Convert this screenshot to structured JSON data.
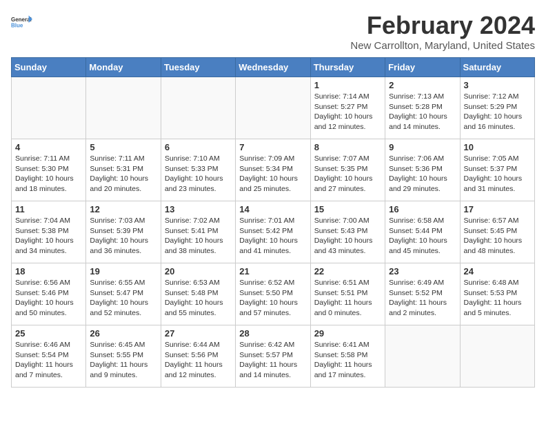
{
  "header": {
    "logo_general": "General",
    "logo_blue": "Blue",
    "month_title": "February 2024",
    "location": "New Carrollton, Maryland, United States"
  },
  "weekdays": [
    "Sunday",
    "Monday",
    "Tuesday",
    "Wednesday",
    "Thursday",
    "Friday",
    "Saturday"
  ],
  "weeks": [
    [
      {
        "day": "",
        "detail": ""
      },
      {
        "day": "",
        "detail": ""
      },
      {
        "day": "",
        "detail": ""
      },
      {
        "day": "",
        "detail": ""
      },
      {
        "day": "1",
        "detail": "Sunrise: 7:14 AM\nSunset: 5:27 PM\nDaylight: 10 hours\nand 12 minutes."
      },
      {
        "day": "2",
        "detail": "Sunrise: 7:13 AM\nSunset: 5:28 PM\nDaylight: 10 hours\nand 14 minutes."
      },
      {
        "day": "3",
        "detail": "Sunrise: 7:12 AM\nSunset: 5:29 PM\nDaylight: 10 hours\nand 16 minutes."
      }
    ],
    [
      {
        "day": "4",
        "detail": "Sunrise: 7:11 AM\nSunset: 5:30 PM\nDaylight: 10 hours\nand 18 minutes."
      },
      {
        "day": "5",
        "detail": "Sunrise: 7:11 AM\nSunset: 5:31 PM\nDaylight: 10 hours\nand 20 minutes."
      },
      {
        "day": "6",
        "detail": "Sunrise: 7:10 AM\nSunset: 5:33 PM\nDaylight: 10 hours\nand 23 minutes."
      },
      {
        "day": "7",
        "detail": "Sunrise: 7:09 AM\nSunset: 5:34 PM\nDaylight: 10 hours\nand 25 minutes."
      },
      {
        "day": "8",
        "detail": "Sunrise: 7:07 AM\nSunset: 5:35 PM\nDaylight: 10 hours\nand 27 minutes."
      },
      {
        "day": "9",
        "detail": "Sunrise: 7:06 AM\nSunset: 5:36 PM\nDaylight: 10 hours\nand 29 minutes."
      },
      {
        "day": "10",
        "detail": "Sunrise: 7:05 AM\nSunset: 5:37 PM\nDaylight: 10 hours\nand 31 minutes."
      }
    ],
    [
      {
        "day": "11",
        "detail": "Sunrise: 7:04 AM\nSunset: 5:38 PM\nDaylight: 10 hours\nand 34 minutes."
      },
      {
        "day": "12",
        "detail": "Sunrise: 7:03 AM\nSunset: 5:39 PM\nDaylight: 10 hours\nand 36 minutes."
      },
      {
        "day": "13",
        "detail": "Sunrise: 7:02 AM\nSunset: 5:41 PM\nDaylight: 10 hours\nand 38 minutes."
      },
      {
        "day": "14",
        "detail": "Sunrise: 7:01 AM\nSunset: 5:42 PM\nDaylight: 10 hours\nand 41 minutes."
      },
      {
        "day": "15",
        "detail": "Sunrise: 7:00 AM\nSunset: 5:43 PM\nDaylight: 10 hours\nand 43 minutes."
      },
      {
        "day": "16",
        "detail": "Sunrise: 6:58 AM\nSunset: 5:44 PM\nDaylight: 10 hours\nand 45 minutes."
      },
      {
        "day": "17",
        "detail": "Sunrise: 6:57 AM\nSunset: 5:45 PM\nDaylight: 10 hours\nand 48 minutes."
      }
    ],
    [
      {
        "day": "18",
        "detail": "Sunrise: 6:56 AM\nSunset: 5:46 PM\nDaylight: 10 hours\nand 50 minutes."
      },
      {
        "day": "19",
        "detail": "Sunrise: 6:55 AM\nSunset: 5:47 PM\nDaylight: 10 hours\nand 52 minutes."
      },
      {
        "day": "20",
        "detail": "Sunrise: 6:53 AM\nSunset: 5:48 PM\nDaylight: 10 hours\nand 55 minutes."
      },
      {
        "day": "21",
        "detail": "Sunrise: 6:52 AM\nSunset: 5:50 PM\nDaylight: 10 hours\nand 57 minutes."
      },
      {
        "day": "22",
        "detail": "Sunrise: 6:51 AM\nSunset: 5:51 PM\nDaylight: 11 hours\nand 0 minutes."
      },
      {
        "day": "23",
        "detail": "Sunrise: 6:49 AM\nSunset: 5:52 PM\nDaylight: 11 hours\nand 2 minutes."
      },
      {
        "day": "24",
        "detail": "Sunrise: 6:48 AM\nSunset: 5:53 PM\nDaylight: 11 hours\nand 5 minutes."
      }
    ],
    [
      {
        "day": "25",
        "detail": "Sunrise: 6:46 AM\nSunset: 5:54 PM\nDaylight: 11 hours\nand 7 minutes."
      },
      {
        "day": "26",
        "detail": "Sunrise: 6:45 AM\nSunset: 5:55 PM\nDaylight: 11 hours\nand 9 minutes."
      },
      {
        "day": "27",
        "detail": "Sunrise: 6:44 AM\nSunset: 5:56 PM\nDaylight: 11 hours\nand 12 minutes."
      },
      {
        "day": "28",
        "detail": "Sunrise: 6:42 AM\nSunset: 5:57 PM\nDaylight: 11 hours\nand 14 minutes."
      },
      {
        "day": "29",
        "detail": "Sunrise: 6:41 AM\nSunset: 5:58 PM\nDaylight: 11 hours\nand 17 minutes."
      },
      {
        "day": "",
        "detail": ""
      },
      {
        "day": "",
        "detail": ""
      }
    ]
  ]
}
